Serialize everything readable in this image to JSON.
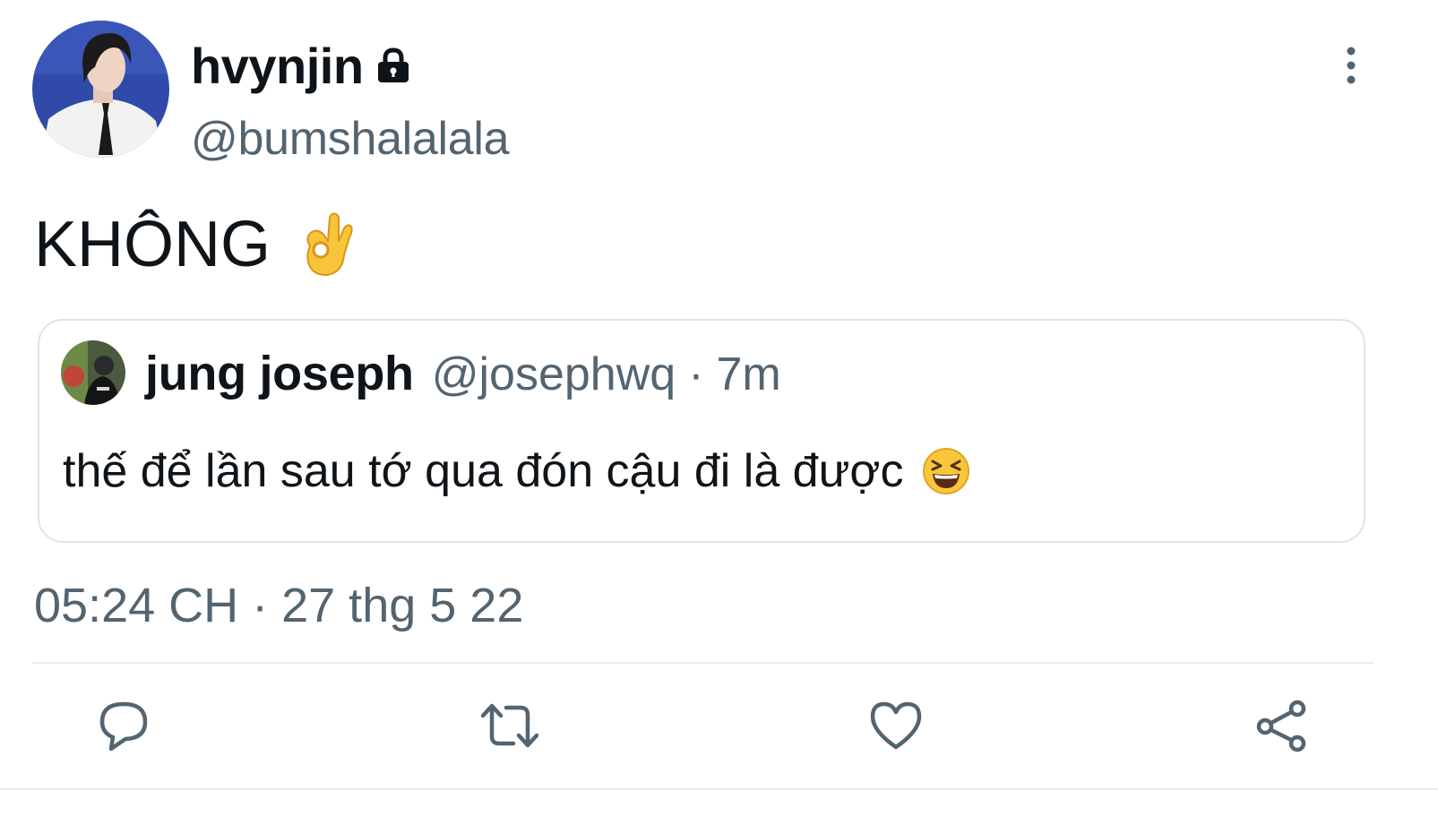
{
  "tweet": {
    "author": {
      "display_name": "hvynjin",
      "handle": "@bumshalalala",
      "protected_icon": "lock-icon",
      "avatar_bg": "#2f4aa8"
    },
    "menu_icon": "more-vertical-icon",
    "text": "KHÔNG",
    "text_emoji": "ok-hand-emoji",
    "quote": {
      "display_name": "jung joseph",
      "handle": "@josephwq",
      "separator": "·",
      "time": "7m",
      "text": "thế để lần sau tớ qua đón cậu đi là được",
      "text_emoji": "laughing-emoji"
    },
    "timestamp": "05:24 CH · 27 thg 5 22"
  },
  "actions": {
    "reply_icon": "reply-icon",
    "retweet_icon": "retweet-icon",
    "like_icon": "heart-icon",
    "share_icon": "share-icon"
  },
  "colors": {
    "text_primary": "#0f1419",
    "text_secondary": "#536471",
    "border": "#dfe4e8"
  }
}
